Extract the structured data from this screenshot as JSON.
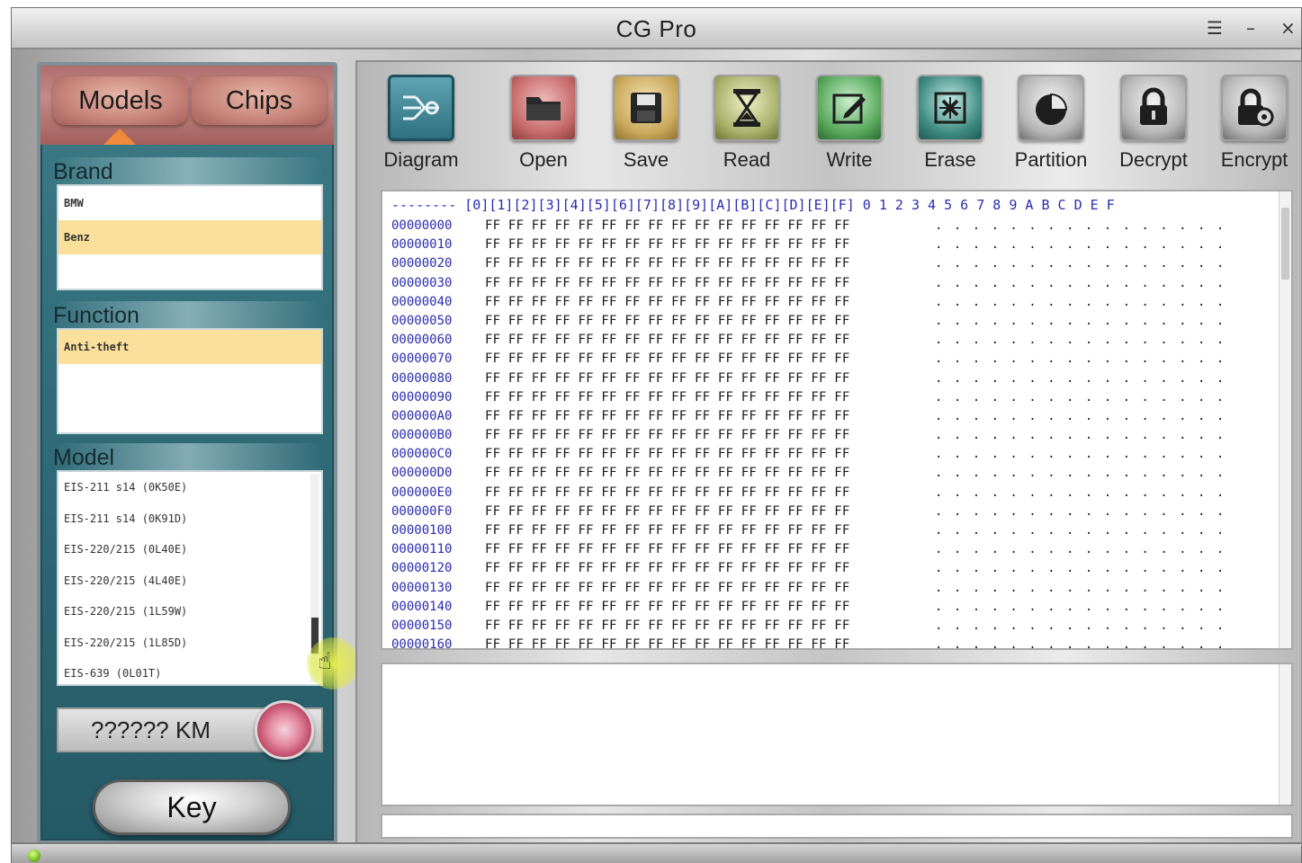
{
  "window": {
    "title": "CG Pro",
    "controls": {
      "menu": "☰",
      "minimize": "–",
      "close": "×"
    }
  },
  "left": {
    "tabs": [
      {
        "label": "Models"
      },
      {
        "label": "Chips"
      }
    ],
    "brand": {
      "label": "Brand",
      "items": [
        {
          "text": "BMW"
        },
        {
          "text": "Benz",
          "selected": true
        }
      ]
    },
    "function": {
      "label": "Function",
      "items": [
        {
          "text": "Anti-theft",
          "selected": true
        }
      ]
    },
    "model": {
      "label": "Model",
      "items": [
        {
          "text": "EIS-211 s14 (0K50E)"
        },
        {
          "text": "EIS-211 s14 (0K91D)"
        },
        {
          "text": "EIS-220/215 (0L40E)"
        },
        {
          "text": "EIS-220/215 (4L40E)"
        },
        {
          "text": "EIS-220/215 (1L59W)"
        },
        {
          "text": "EIS-220/215 (1L85D)"
        },
        {
          "text": "EIS-639 (0L01T)"
        }
      ]
    },
    "km_display": "?????? KM",
    "key_button": "Key"
  },
  "toolbar": [
    {
      "label": "Diagram",
      "icon": "diagram-icon",
      "color": "#2f6f80"
    },
    {
      "label": "Open",
      "icon": "folder-icon",
      "color": "#c56a6a"
    },
    {
      "label": "Save",
      "icon": "floppy-disk-icon",
      "color": "#c9a85a"
    },
    {
      "label": "Read",
      "icon": "hourglass-icon",
      "color": "#a8b06a"
    },
    {
      "label": "Write",
      "icon": "pencil-icon",
      "color": "#58a85c"
    },
    {
      "label": "Erase",
      "icon": "eraser-icon",
      "color": "#3d8a80"
    },
    {
      "label": "Partition",
      "icon": "pie-chart-icon",
      "color": "#7a7a7a"
    },
    {
      "label": "Decrypt",
      "icon": "lock-icon",
      "color": "#7a7a7a"
    },
    {
      "label": "Encrypt",
      "icon": "lock-gear-icon",
      "color": "#7a7a7a"
    }
  ],
  "hex": {
    "header": "--------  [0][1][2][3][4][5][6][7][8][9][A][B][C][D][E][F]   0 1 2 3 4 5 6 7 8 9 A B C D E F",
    "bytes": "FF FF FF FF FF FF FF FF FF FF FF FF FF FF FF FF",
    "ascii": ". . . . . . . . . . . . . . . .",
    "rows": [
      "00000000",
      "00000010",
      "00000020",
      "00000030",
      "00000040",
      "00000050",
      "00000060",
      "00000070",
      "00000080",
      "00000090",
      "000000A0",
      "000000B0",
      "000000C0",
      "000000D0",
      "000000E0",
      "000000F0",
      "00000100",
      "00000110",
      "00000120",
      "00000130",
      "00000140",
      "00000150",
      "00000160"
    ]
  }
}
